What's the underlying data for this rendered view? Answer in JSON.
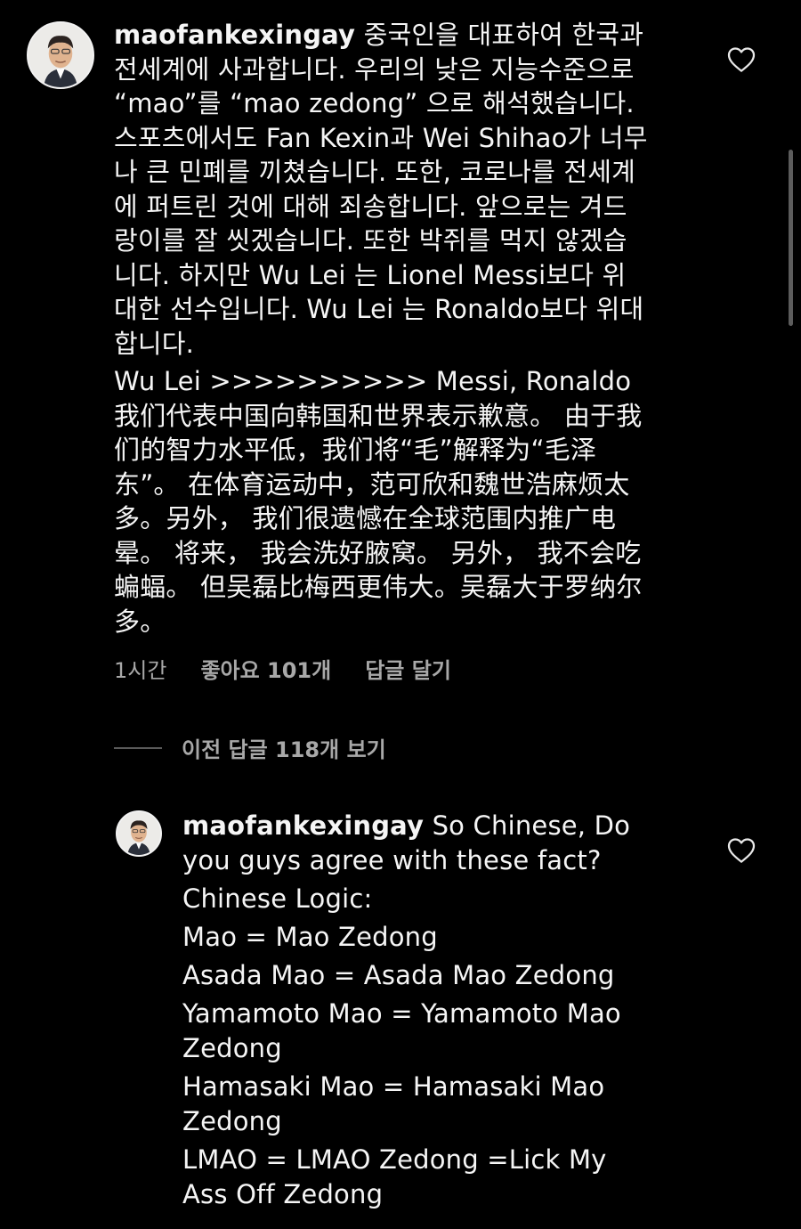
{
  "comment1": {
    "username": "maofankexingay",
    "avatar_icon": "profile-photo-man-icon",
    "lines": [
      "중국인을 대표하여 한국과",
      "전세계에 사과합니다. 우리의 낮은 지능수준으로",
      "“mao”를 “mao zedong” 으로 해석했습니다.",
      "스포츠에서도 Fan Kexin과 Wei Shihao가 너무",
      "나 큰 민폐를 끼쳤습니다. 또한, 코로나를 전세계",
      "에 퍼트린 것에 대해 죄송합니다. 앞으로는 겨드",
      "랑이를 잘 씻겠습니다. 또한 박쥐를 먹지 않겠습",
      "니다. 하지만 Wu Lei 는 Lionel Messi보다 위",
      "대한 선수입니다. Wu Lei 는 Ronaldo보다 위대",
      "합니다.",
      "Wu Lei >>>>>>>>>> Messi, Ronaldo",
      "我们代表中国向韩国和世界表示歉意。 由于我",
      "们的智力水平低，我们将“毛”解释为“毛泽",
      "东”。 在体育运动中，范可欣和魏世浩麻烦太",
      "多。另外， 我们很遗憾在全球范围内推广电",
      "晕。 将来， 我会洗好腋窝。 另外， 我不会吃",
      "蝙蝠。 但吴磊比梅西更伟大。吴磊大于罗纳尔",
      "多。"
    ],
    "time": "1시간",
    "likes": "좋아요 101개",
    "reply_label": "답글 달기",
    "heart_icon": "heart-outline-icon"
  },
  "view_replies": {
    "label": "이전 답글 118개 보기"
  },
  "comment2": {
    "username": "maofankexingay",
    "avatar_icon": "profile-photo-man-icon",
    "lines": [
      "So Chinese, Do",
      "you guys agree with these fact?",
      "Chinese Logic:",
      "Mao = Mao Zedong",
      "Asada Mao = Asada Mao Zedong",
      "Yamamoto Mao = Yamamoto Mao",
      "Zedong",
      "Hamasaki Mao = Hamasaki Mao",
      "Zedong",
      "LMAO = LMAO Zedong =Lick My",
      "Ass Off Zedong"
    ],
    "heart_icon": "heart-outline-icon"
  },
  "colors": {
    "background": "#000000",
    "text": "#f5f5f5",
    "secondary_text": "#a8a8a8"
  }
}
